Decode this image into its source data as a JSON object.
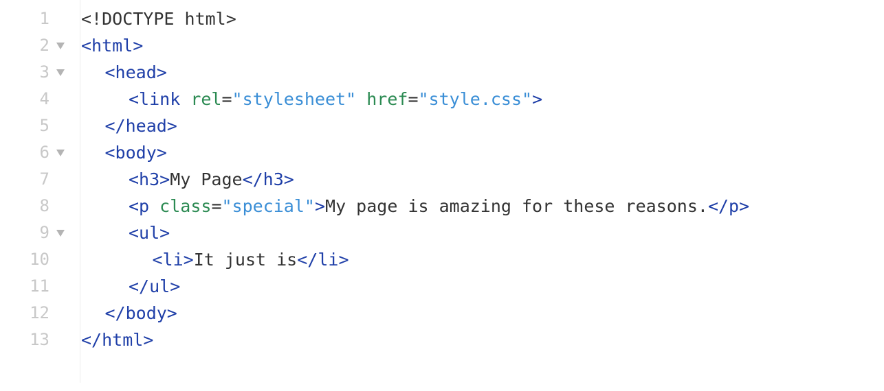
{
  "editor": {
    "language": "html",
    "colors": {
      "tag": "#1f3fa8",
      "attribute": "#2b8a52",
      "value": "#3a8ed6",
      "text": "#333333",
      "gutter_text": "#c8c8c8",
      "fold_icon": "#b4b4b4"
    },
    "lines": [
      {
        "number": "1",
        "foldable": false,
        "indent": 0,
        "tokens": [
          {
            "t": "txt",
            "v": "<!DOCTYPE html>"
          }
        ]
      },
      {
        "number": "2",
        "foldable": true,
        "indent": 0,
        "tokens": [
          {
            "t": "tag",
            "v": "<html>"
          }
        ]
      },
      {
        "number": "3",
        "foldable": true,
        "indent": 1,
        "tokens": [
          {
            "t": "tag",
            "v": "<head>"
          }
        ]
      },
      {
        "number": "4",
        "foldable": false,
        "indent": 2,
        "tokens": [
          {
            "t": "tag",
            "v": "<link"
          },
          {
            "t": "txt",
            "v": " "
          },
          {
            "t": "attr",
            "v": "rel"
          },
          {
            "t": "punct",
            "v": "="
          },
          {
            "t": "val",
            "v": "\"stylesheet\""
          },
          {
            "t": "txt",
            "v": " "
          },
          {
            "t": "attr",
            "v": "href"
          },
          {
            "t": "punct",
            "v": "="
          },
          {
            "t": "val",
            "v": "\"style.css\""
          },
          {
            "t": "tag",
            "v": ">"
          }
        ]
      },
      {
        "number": "5",
        "foldable": false,
        "indent": 1,
        "tokens": [
          {
            "t": "tag",
            "v": "</head>"
          }
        ]
      },
      {
        "number": "6",
        "foldable": true,
        "indent": 1,
        "tokens": [
          {
            "t": "tag",
            "v": "<body>"
          }
        ]
      },
      {
        "number": "7",
        "foldable": false,
        "indent": 2,
        "tokens": [
          {
            "t": "tag",
            "v": "<h3>"
          },
          {
            "t": "txt",
            "v": "My Page"
          },
          {
            "t": "tag",
            "v": "</h3>"
          }
        ]
      },
      {
        "number": "8",
        "foldable": false,
        "indent": 2,
        "tokens": [
          {
            "t": "tag",
            "v": "<p"
          },
          {
            "t": "txt",
            "v": " "
          },
          {
            "t": "attr",
            "v": "class"
          },
          {
            "t": "punct",
            "v": "="
          },
          {
            "t": "val",
            "v": "\"special\""
          },
          {
            "t": "tag",
            "v": ">"
          },
          {
            "t": "txt",
            "v": "My page is amazing for these reasons."
          },
          {
            "t": "tag",
            "v": "</p>"
          }
        ]
      },
      {
        "number": "9",
        "foldable": true,
        "indent": 2,
        "tokens": [
          {
            "t": "tag",
            "v": "<ul>"
          }
        ]
      },
      {
        "number": "10",
        "foldable": false,
        "indent": 3,
        "tokens": [
          {
            "t": "tag",
            "v": "<li>"
          },
          {
            "t": "txt",
            "v": "It just is"
          },
          {
            "t": "tag",
            "v": "</li>"
          }
        ]
      },
      {
        "number": "11",
        "foldable": false,
        "indent": 2,
        "tokens": [
          {
            "t": "tag",
            "v": "</ul>"
          }
        ]
      },
      {
        "number": "12",
        "foldable": false,
        "indent": 1,
        "tokens": [
          {
            "t": "tag",
            "v": "</body>"
          }
        ]
      },
      {
        "number": "13",
        "foldable": false,
        "indent": 0,
        "tokens": [
          {
            "t": "tag",
            "v": "</html>"
          }
        ]
      }
    ]
  }
}
